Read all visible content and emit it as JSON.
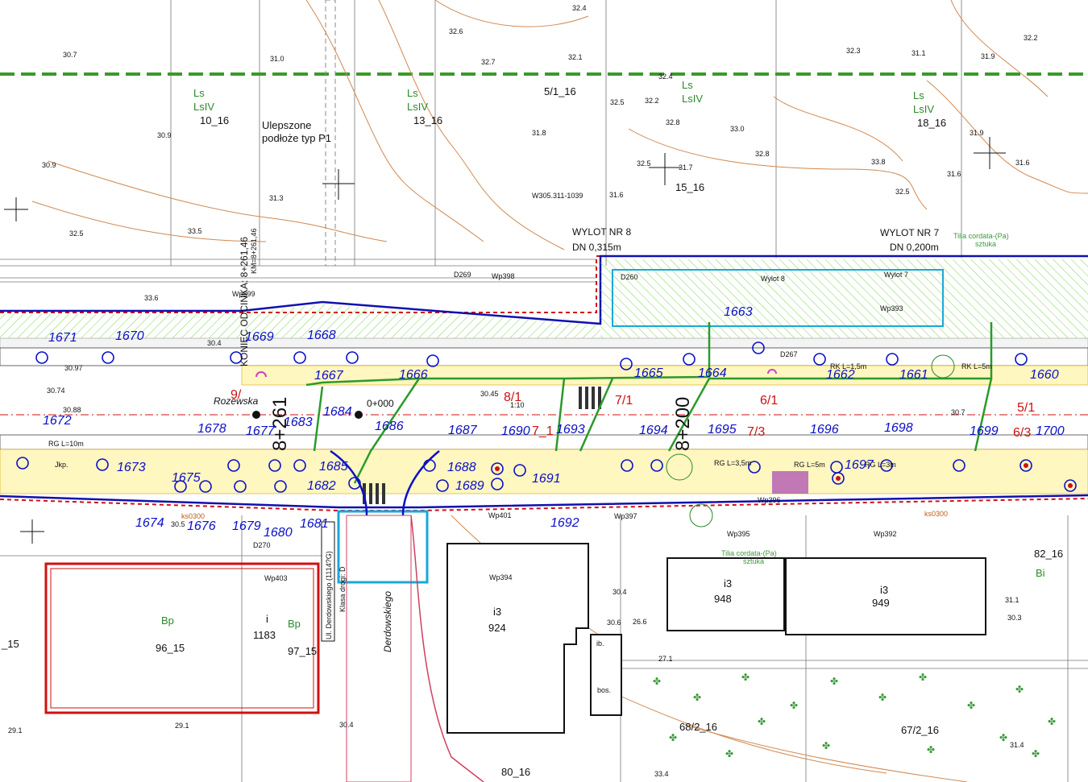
{
  "labels": {
    "ulepszone_line1": "Ulepszone",
    "ulepszone_line2": "podłoże typ P1",
    "wylot8_name": "WYLOT NR 8",
    "wylot8_dn": "DN 0,315m",
    "wylot7_name": "WYLOT NR 7",
    "wylot7_dn": "DN 0,200m",
    "tilia_1": "Tilia cordata-(Pa)",
    "tilia_1b": "sztuka",
    "tilia_2": "Tilia cordata-(Pa)",
    "tilia_2b": "sztuka",
    "street_name": "Ul. Derdowskiego (1114?G)",
    "street_class": "Klasa drogi: D",
    "derdowskiego": "Derdowskiego",
    "rozewska": "Rozewska",
    "ptr_code": "W305.311-1039",
    "d260": "D260",
    "d269": "D269",
    "d270": "D270",
    "d267": "D267"
  },
  "parcels": [
    {
      "id": "10_16",
      "use1": "Ls",
      "use2": "LsIV"
    },
    {
      "id": "13_16",
      "use1": "Ls",
      "use2": "LsIV"
    },
    {
      "id": "5/1_16"
    },
    {
      "id": "15_16"
    },
    {
      "id": "18_16",
      "use1": "Ls",
      "use2": "LsIV"
    },
    {
      "id": "96_15",
      "use1": "Bp"
    },
    {
      "id": "97_15",
      "use1": "Bp"
    },
    {
      "id": "82_16",
      "use1": "Bi"
    },
    {
      "id": "68/2_16"
    },
    {
      "id": "67/2_16"
    },
    {
      "id": "80_16"
    },
    {
      "id": "_15"
    }
  ],
  "buildings": [
    {
      "use": "i3",
      "num": "924"
    },
    {
      "use": "i3",
      "num": "948"
    },
    {
      "use": "i3",
      "num": "949"
    },
    {
      "use": "i",
      "num": "1183"
    },
    {
      "use": "ib.",
      "num": "bos."
    }
  ],
  "stations": {
    "s1": "8+261",
    "s2": "8+200",
    "s1_text": "KONIEC ODCINKA: 8+261,46",
    "s1_text2": "KM=8+261,46",
    "km0": "0+000"
  },
  "points": [
    "1671",
    "1670",
    "1669",
    "1668",
    "1667",
    "1666",
    "1665",
    "1664",
    "1663",
    "1662",
    "1661",
    "1660",
    "1672",
    "1673",
    "1674",
    "1675",
    "1676",
    "1677",
    "1678",
    "1679",
    "1680",
    "1681",
    "1682",
    "1683",
    "1684",
    "1685",
    "1686",
    "1687",
    "1688",
    "1689",
    "1690",
    "1691",
    "1692",
    "1693",
    "1694",
    "1695",
    "1696",
    "1697",
    "1698",
    "1699",
    "1700"
  ],
  "red_labels": [
    "9/",
    "8/1",
    "7/1",
    "6/1",
    "5/1",
    "7/3",
    "6/3",
    "7_1"
  ],
  "elevations": [
    "30.7",
    "31.0",
    "32.4",
    "32.6",
    "32.7",
    "32.1",
    "32.3",
    "32.2",
    "31.1",
    "31.9",
    "30.9",
    "32.4",
    "32.5",
    "32.2",
    "33.0",
    "31.9",
    "31.8",
    "32.8",
    "32.8",
    "30.9",
    "33.8",
    "31.6",
    "32.5",
    "31.7",
    "31.3",
    "31.6",
    "32.5",
    "33.5",
    "31.6",
    "32.5",
    "30.4",
    "33.6",
    "30.97",
    "30.74",
    "30.88",
    "30.45",
    "30.7",
    "30.5",
    "30.4",
    "29.1",
    "30.3",
    "31.1",
    "30.6",
    "29.1",
    "31.4",
    "33.4",
    "30.4",
    "27.1",
    "26.6"
  ],
  "wp": [
    "Wp399",
    "Wp398",
    "Wp393",
    "Wp397",
    "Wp401",
    "Wp394",
    "Wp403",
    "Wp395",
    "Wp392",
    "Wp396",
    "Wylot 8",
    "Wylot 7"
  ],
  "small_notes": [
    "1:10",
    "Jkp.",
    "RG L=10m",
    "RG L=3m",
    "RG L=5m",
    "RG L=3,5m",
    "RK L=5m",
    "RK L=1,5m",
    "ks0300",
    "ks0300"
  ]
}
